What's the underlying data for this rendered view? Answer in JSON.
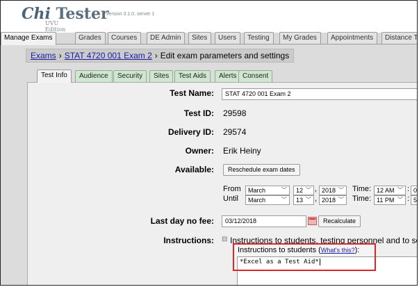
{
  "header": {
    "logo_chi": "Chi",
    "logo_tester": "Tester",
    "logo_edition": "UVU Edition",
    "version": "version 3.1.0, server 1"
  },
  "nav": {
    "tabs": [
      {
        "label": "Manage Exams",
        "active": true
      },
      {
        "label": "Grades"
      },
      {
        "label": "Courses"
      },
      {
        "label": "DE Admin"
      },
      {
        "label": "Sites"
      },
      {
        "label": "Users"
      },
      {
        "label": "Testing"
      },
      {
        "label": "My Grades"
      },
      {
        "label": "Appointments"
      },
      {
        "label": "Distance T"
      }
    ]
  },
  "breadcrumb": {
    "exams": "Exams",
    "sep1": "›",
    "exam": "STAT 4720 001 Exam 2",
    "sep2": "›",
    "current": "Edit exam parameters and settings"
  },
  "subtabs": [
    {
      "label": "Test Info",
      "active": true
    },
    {
      "label": "Audience"
    },
    {
      "label": "Security"
    },
    {
      "label": "Sites"
    },
    {
      "label": "Test Aids"
    },
    {
      "label": "Alerts"
    },
    {
      "label": "Consent"
    }
  ],
  "form": {
    "test_name_label": "Test Name:",
    "test_name_value": "STAT 4720 001 Exam 2",
    "test_id_label": "Test ID:",
    "test_id_value": "29598",
    "delivery_id_label": "Delivery ID:",
    "delivery_id_value": "29574",
    "owner_label": "Owner:",
    "owner_value": "Erik Heiny",
    "available_label": "Available:",
    "reschedule_button": "Reschedule exam dates",
    "from_label": "From",
    "until_label": "Until",
    "from_month": "March",
    "from_day": "12",
    "from_year": "2018",
    "from_time_label": "Time:",
    "from_time": "12 AM",
    "from_min": "0",
    "until_month": "March",
    "until_day": "13",
    "until_year": "2018",
    "until_time_label": "Time:",
    "until_time": "11 PM",
    "until_min": "5",
    "comma": ",",
    "colon": ":",
    "last_day_label": "Last day no fee:",
    "last_day_value": "03/12/2018",
    "recalculate_button": "Recalculate",
    "instructions_label": "Instructions:",
    "instructions_toggle": "⊟",
    "instructions_text": "Instructions to students, testing personnel and to se",
    "instr_students_label": "Instructions to students (",
    "whats_this": "What's this?",
    "instr_students_close": "):",
    "instr_students_value": "*Excel as a Test Aid*"
  },
  "colors": {
    "highlight_border": "#d9262b",
    "link": "#1a1aa6",
    "subtab_bg": "#cfe6cf"
  }
}
